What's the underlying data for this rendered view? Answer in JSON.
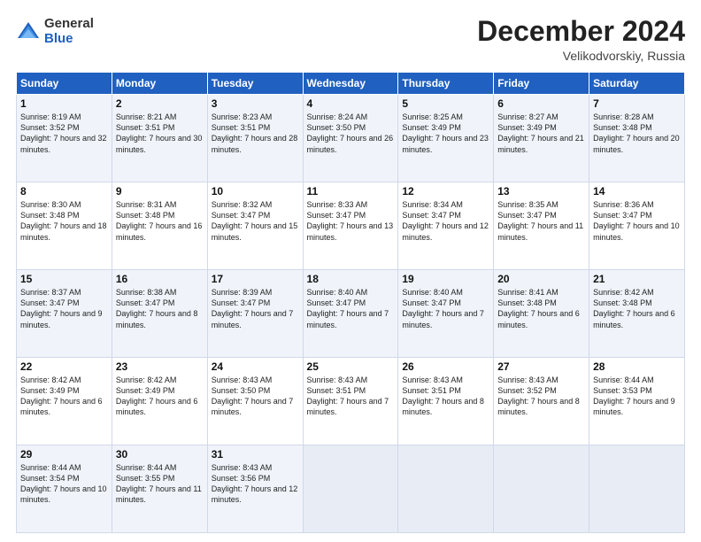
{
  "header": {
    "logo_general": "General",
    "logo_blue": "Blue",
    "month_title": "December 2024",
    "location": "Velikodvorskiy, Russia"
  },
  "weekdays": [
    "Sunday",
    "Monday",
    "Tuesday",
    "Wednesday",
    "Thursday",
    "Friday",
    "Saturday"
  ],
  "weeks": [
    [
      {
        "day": "1",
        "sunrise": "8:19 AM",
        "sunset": "3:52 PM",
        "daylight": "7 hours and 32 minutes."
      },
      {
        "day": "2",
        "sunrise": "8:21 AM",
        "sunset": "3:51 PM",
        "daylight": "7 hours and 30 minutes."
      },
      {
        "day": "3",
        "sunrise": "8:23 AM",
        "sunset": "3:51 PM",
        "daylight": "7 hours and 28 minutes."
      },
      {
        "day": "4",
        "sunrise": "8:24 AM",
        "sunset": "3:50 PM",
        "daylight": "7 hours and 26 minutes."
      },
      {
        "day": "5",
        "sunrise": "8:25 AM",
        "sunset": "3:49 PM",
        "daylight": "7 hours and 23 minutes."
      },
      {
        "day": "6",
        "sunrise": "8:27 AM",
        "sunset": "3:49 PM",
        "daylight": "7 hours and 21 minutes."
      },
      {
        "day": "7",
        "sunrise": "8:28 AM",
        "sunset": "3:48 PM",
        "daylight": "7 hours and 20 minutes."
      }
    ],
    [
      {
        "day": "8",
        "sunrise": "8:30 AM",
        "sunset": "3:48 PM",
        "daylight": "7 hours and 18 minutes."
      },
      {
        "day": "9",
        "sunrise": "8:31 AM",
        "sunset": "3:48 PM",
        "daylight": "7 hours and 16 minutes."
      },
      {
        "day": "10",
        "sunrise": "8:32 AM",
        "sunset": "3:47 PM",
        "daylight": "7 hours and 15 minutes."
      },
      {
        "day": "11",
        "sunrise": "8:33 AM",
        "sunset": "3:47 PM",
        "daylight": "7 hours and 13 minutes."
      },
      {
        "day": "12",
        "sunrise": "8:34 AM",
        "sunset": "3:47 PM",
        "daylight": "7 hours and 12 minutes."
      },
      {
        "day": "13",
        "sunrise": "8:35 AM",
        "sunset": "3:47 PM",
        "daylight": "7 hours and 11 minutes."
      },
      {
        "day": "14",
        "sunrise": "8:36 AM",
        "sunset": "3:47 PM",
        "daylight": "7 hours and 10 minutes."
      }
    ],
    [
      {
        "day": "15",
        "sunrise": "8:37 AM",
        "sunset": "3:47 PM",
        "daylight": "7 hours and 9 minutes."
      },
      {
        "day": "16",
        "sunrise": "8:38 AM",
        "sunset": "3:47 PM",
        "daylight": "7 hours and 8 minutes."
      },
      {
        "day": "17",
        "sunrise": "8:39 AM",
        "sunset": "3:47 PM",
        "daylight": "7 hours and 7 minutes."
      },
      {
        "day": "18",
        "sunrise": "8:40 AM",
        "sunset": "3:47 PM",
        "daylight": "7 hours and 7 minutes."
      },
      {
        "day": "19",
        "sunrise": "8:40 AM",
        "sunset": "3:47 PM",
        "daylight": "7 hours and 7 minutes."
      },
      {
        "day": "20",
        "sunrise": "8:41 AM",
        "sunset": "3:48 PM",
        "daylight": "7 hours and 6 minutes."
      },
      {
        "day": "21",
        "sunrise": "8:42 AM",
        "sunset": "3:48 PM",
        "daylight": "7 hours and 6 minutes."
      }
    ],
    [
      {
        "day": "22",
        "sunrise": "8:42 AM",
        "sunset": "3:49 PM",
        "daylight": "7 hours and 6 minutes."
      },
      {
        "day": "23",
        "sunrise": "8:42 AM",
        "sunset": "3:49 PM",
        "daylight": "7 hours and 6 minutes."
      },
      {
        "day": "24",
        "sunrise": "8:43 AM",
        "sunset": "3:50 PM",
        "daylight": "7 hours and 7 minutes."
      },
      {
        "day": "25",
        "sunrise": "8:43 AM",
        "sunset": "3:51 PM",
        "daylight": "7 hours and 7 minutes."
      },
      {
        "day": "26",
        "sunrise": "8:43 AM",
        "sunset": "3:51 PM",
        "daylight": "7 hours and 8 minutes."
      },
      {
        "day": "27",
        "sunrise": "8:43 AM",
        "sunset": "3:52 PM",
        "daylight": "7 hours and 8 minutes."
      },
      {
        "day": "28",
        "sunrise": "8:44 AM",
        "sunset": "3:53 PM",
        "daylight": "7 hours and 9 minutes."
      }
    ],
    [
      {
        "day": "29",
        "sunrise": "8:44 AM",
        "sunset": "3:54 PM",
        "daylight": "7 hours and 10 minutes."
      },
      {
        "day": "30",
        "sunrise": "8:44 AM",
        "sunset": "3:55 PM",
        "daylight": "7 hours and 11 minutes."
      },
      {
        "day": "31",
        "sunrise": "8:43 AM",
        "sunset": "3:56 PM",
        "daylight": "7 hours and 12 minutes."
      },
      null,
      null,
      null,
      null
    ]
  ]
}
